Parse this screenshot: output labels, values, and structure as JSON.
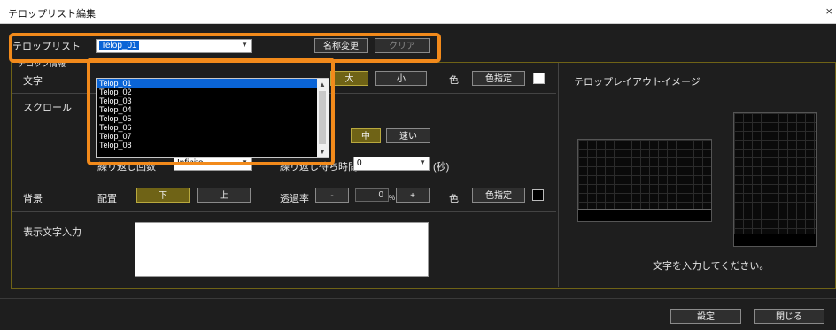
{
  "window": {
    "title": "テロップリスト編集",
    "close": "×"
  },
  "telop_list": {
    "label": "テロップリスト",
    "selected": "Telop_01",
    "rename_label": "名称変更",
    "clear_label": "クリア",
    "options": [
      "Telop_01",
      "Telop_02",
      "Telop_03",
      "Telop_04",
      "Telop_05",
      "Telop_06",
      "Telop_07",
      "Telop_08"
    ]
  },
  "info": {
    "group_label": "テロップ情報",
    "text_label": "文字",
    "size_large": "大",
    "size_small": "小",
    "color_label": "色",
    "color_button": "色指定",
    "scroll_label": "スクロール",
    "speed_mid": "中",
    "speed_fast": "速い",
    "repeat_count_label": "繰り返し回数",
    "repeat_count_value": "Infinite",
    "repeat_wait_label": "繰り返し待ち時間",
    "repeat_wait_value": "0",
    "repeat_wait_unit": "(秒)",
    "bg_label": "背景",
    "placement_label": "配置",
    "placement_down": "下",
    "placement_up": "上",
    "opacity_label": "透過率",
    "opacity_minus": "-",
    "opacity_value": "0",
    "opacity_unit": "%",
    "opacity_plus": "+",
    "bg_color_label": "色",
    "bg_color_button": "色指定",
    "input_label": "表示文字入力",
    "input_value": ""
  },
  "preview": {
    "title": "テロップレイアウトイメージ",
    "prompt": "文字を入力してください。"
  },
  "footer": {
    "ok_label": "設定",
    "close_label": "閉じる"
  },
  "colors": {
    "accent": "#f28a1b",
    "gold": "#6f6316",
    "background": "#1e1e1e"
  }
}
